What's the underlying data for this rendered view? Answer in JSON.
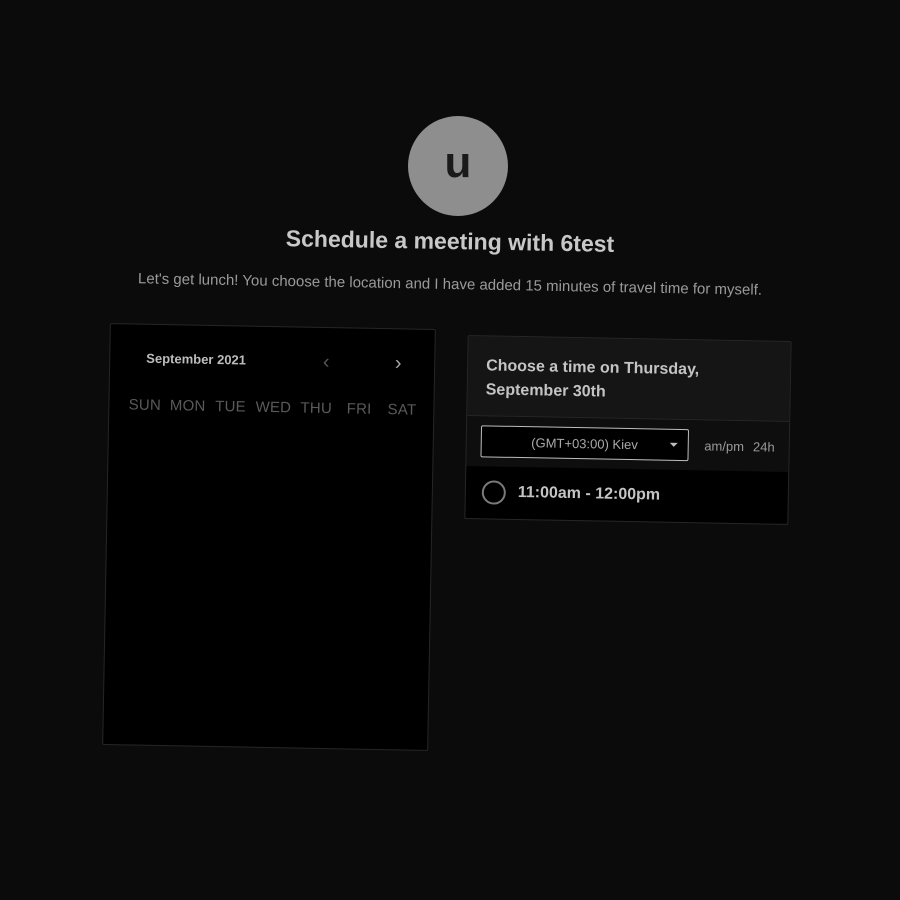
{
  "host": {
    "avatar_initial": "u",
    "title": "Schedule a meeting with 6test",
    "description": "Let's get lunch! You choose the location and I have added 15 minutes of travel time for myself."
  },
  "calendar": {
    "month_label": "September 2021",
    "prev_icon": "chevron-left-icon",
    "next_icon": "chevron-right-icon",
    "weekdays": [
      "SUN",
      "MON",
      "TUE",
      "WED",
      "THU",
      "FRI",
      "SAT"
    ]
  },
  "time_picker": {
    "heading": "Choose a time on Thursday, September 30th",
    "timezone_selected": "(GMT+03:00) Kiev",
    "format_options": [
      "am/pm",
      "24h"
    ],
    "slots": [
      "11:00am - 12:00pm"
    ]
  }
}
